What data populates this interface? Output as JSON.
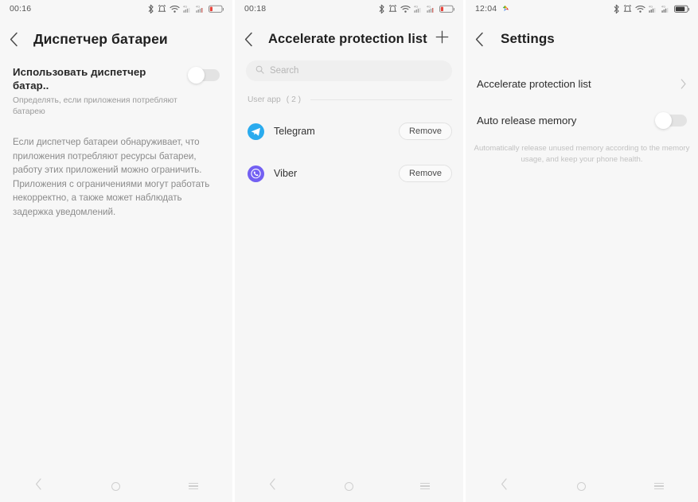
{
  "panels": [
    {
      "status": {
        "time": "00:16",
        "icons": [
          "bluetooth-icon",
          "alarm-icon",
          "wifi-icon",
          "signal-1-icon",
          "signal-2-icon",
          "battery-low-icon"
        ],
        "battery_state": "low"
      },
      "header": {
        "back_icon": "chevron-left-icon",
        "title": "Диспетчер батареи"
      },
      "setting": {
        "title": "Использовать диспетчер батар..",
        "subtitle": "Определять, если приложения потребляют батарею",
        "toggle_state": "off"
      },
      "description": "Если диспетчер батареи обнаруживает, что приложения потребляют ресурсы батареи, работу этих приложений можно ограничить. Приложения с ограничениями могут работать некорректно, а также может наблюдать задержка уведомлений."
    },
    {
      "status": {
        "time": "00:18",
        "icons": [
          "bluetooth-icon",
          "alarm-icon",
          "wifi-icon",
          "signal-1-icon",
          "signal-2-icon",
          "battery-low-icon"
        ],
        "battery_state": "low"
      },
      "header": {
        "back_icon": "chevron-left-icon",
        "title": "Accelerate protection list",
        "add_icon": "plus-icon"
      },
      "search": {
        "icon": "search-icon",
        "placeholder": "Search",
        "value": ""
      },
      "section": {
        "label": "User app",
        "count": "( 2 )"
      },
      "apps": [
        {
          "name": "Telegram",
          "icon": "telegram-icon",
          "icon_color": "#2AABEE",
          "action_label": "Remove"
        },
        {
          "name": "Viber",
          "icon": "viber-icon",
          "icon_color": "#7360F2",
          "action_label": "Remove"
        }
      ]
    },
    {
      "status": {
        "time": "12:04",
        "lead_icon": "colorful-app-icon",
        "icons": [
          "bluetooth-icon",
          "alarm-icon",
          "wifi-icon",
          "signal-1-icon",
          "signal-2-icon",
          "battery-full-icon"
        ],
        "battery_state": "full"
      },
      "header": {
        "back_icon": "chevron-left-icon",
        "title": "Settings"
      },
      "rows": [
        {
          "label": "Accelerate protection list",
          "type": "link",
          "chevron": "chevron-right-icon"
        },
        {
          "label": "Auto release memory",
          "type": "toggle",
          "toggle_state": "off"
        }
      ],
      "helper_text": "Automatically release unused memory according to the memory usage, and keep your phone health."
    }
  ],
  "navbar": {
    "back_icon": "nav-back-icon",
    "home_icon": "nav-home-icon",
    "recents_icon": "nav-recents-icon"
  },
  "colors": {
    "background": "#f7f7f7",
    "title": "#1f1f1f",
    "muted": "#9b9b9b",
    "battery_low": "#e8453c",
    "telegram": "#2AABEE",
    "viber": "#7360F2"
  }
}
